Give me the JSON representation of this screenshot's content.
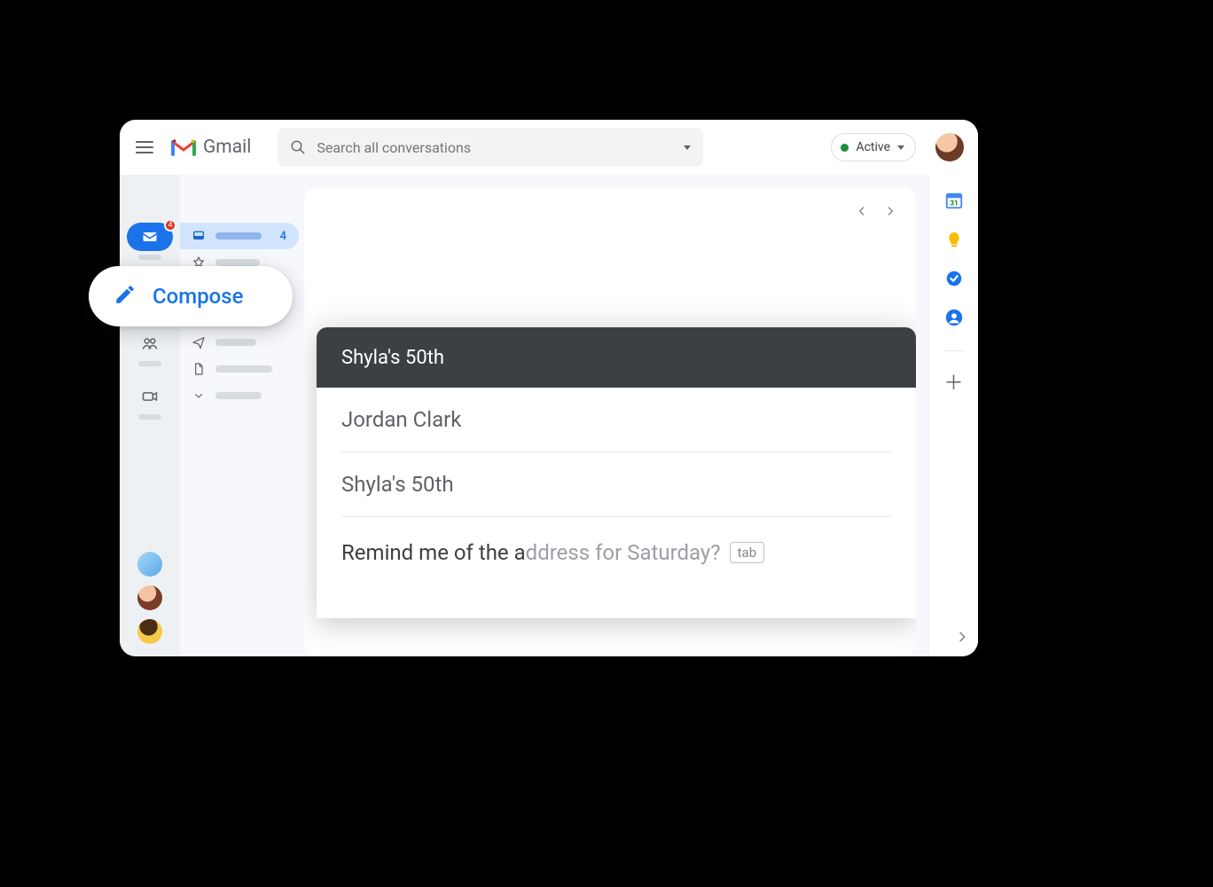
{
  "header": {
    "app_name": "Gmail",
    "search_placeholder": "Search all conversations",
    "status_label": "Active"
  },
  "rail": {
    "mail_badge": "4"
  },
  "folders": {
    "inbox_count": "4"
  },
  "compose_button": {
    "label": "Compose"
  },
  "compose_window": {
    "title": "Shyla's 50th",
    "to": "Jordan Clark",
    "subject": "Shyla's 50th",
    "body_typed": "Remind me of the a",
    "body_suggestion": "ddress for Saturday?",
    "tab_hint": "tab"
  }
}
